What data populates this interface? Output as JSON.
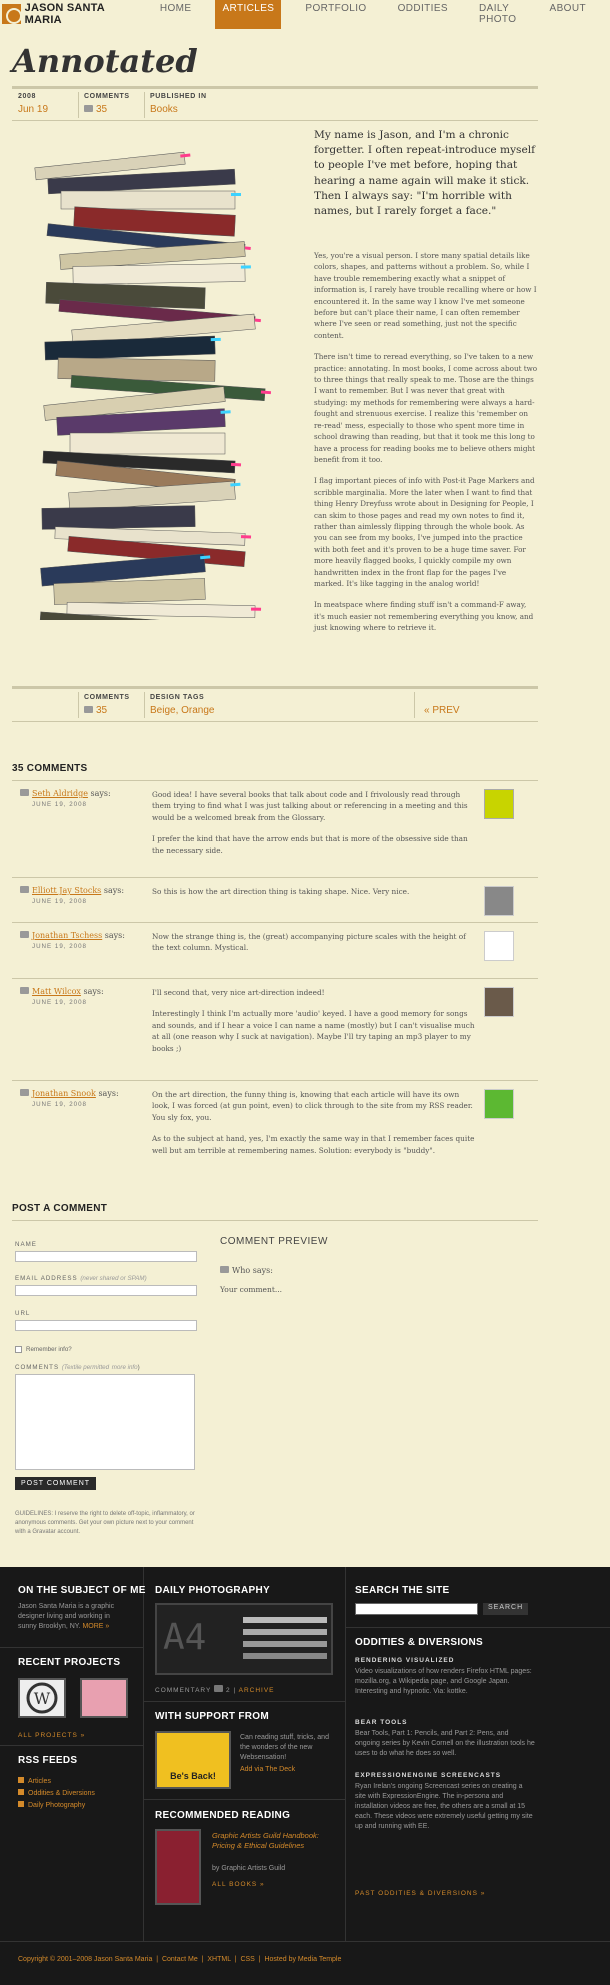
{
  "header": {
    "logo_text": "JASON SANTA MARIA",
    "nav": [
      {
        "label": "HOME"
      },
      {
        "label": "ARTICLES"
      },
      {
        "label": "PORTFOLIO"
      },
      {
        "label": "ODDITIES"
      },
      {
        "label": "DAILY PHOTO"
      },
      {
        "label": "ABOUT"
      }
    ]
  },
  "article": {
    "title": "Annotated",
    "meta": {
      "year": "2008",
      "date": "Jun 19",
      "comments_label": "COMMENTS",
      "comments_count": "35",
      "published_label": "PUBLISHED IN",
      "published_value": "Books"
    },
    "intro": "My name is Jason, and I'm a chronic forgetter. I often repeat-introduce myself to people I've met before, hoping that hearing a name again will make it stick. Then I always say: \"I'm horrible with names, but I rarely forget a face.\"",
    "paragraphs": [
      "Yes, you're a visual person. I store many spatial details like colors, shapes, and patterns without a problem. So, while I have trouble remembering exactly what a snippet of information is, I rarely have trouble recalling where or how I encountered it. In the same way I know I've met someone before but can't place their name, I can often remember where I've seen or read something, just not the specific content.",
      "There isn't time to reread everything, so I've taken to a new practice: annotating. In most books, I come across about two to three things that really speak to me. Those are the things I want to remember. But I was never that great with studying: my methods for remembering were always a hard-fought and strenuous exercise. I realize this 'remember on re-read' mess, especially to those who spent more time in school drawing than reading, but that it took me this long to have a process for reading books me to believe others might benefit from it too.",
      "I flag important pieces of info with Post-it Page Markers and scribble marginalia. More the later when I want to find that thing Henry Dreyfuss wrote about in Designing for People, I can skim to those pages and read my own notes to find it, rather than aimlessly flipping through the whole book. As you can see from my books, I've jumped into the practice with both feet and it's proven to be a huge time saver. For more heavily flagged books, I quickly compile my own handwritten index in the front flap for the pages I've marked. It's like tagging in the analog world!",
      "In meatspace where finding stuff isn't a command-F away, it's much easier not remembering everything you know, and just knowing where to retrieve it."
    ],
    "bottom_meta": {
      "comments_label": "COMMENTS",
      "comments_count": "35",
      "design_tags_label": "DESIGN TAGS",
      "design_tags_value": "Beige, Orange",
      "prev_label": "« PREV"
    }
  },
  "comments": {
    "title": "35 COMMENTS",
    "items": [
      {
        "author": "Seth Aldridge",
        "says": "says:",
        "date": "JUNE 19, 2008",
        "paragraphs": [
          "Good idea! I have several books that talk about code and I frivolously read through them trying to find what I was just talking about or referencing in a meeting and this would be a welcomed break from the Glossary.",
          "I prefer the kind that have the arrow ends but that is more of the obsessive side than the necessary side."
        ]
      },
      {
        "author": "Elliott Jay Stocks",
        "says": "says:",
        "date": "JUNE 19, 2008",
        "paragraphs": [
          "So this is how the art direction thing is taking shape. Nice. Very nice."
        ]
      },
      {
        "author": "Jonathan Tschess",
        "says": "says:",
        "date": "JUNE 19, 2008",
        "paragraphs": [
          "Now the strange thing is, the (great) accompanying picture scales with the height of the text column. Mystical."
        ]
      },
      {
        "author": "Matt Wilcox",
        "says": "says:",
        "date": "JUNE 19, 2008",
        "paragraphs": [
          "I'll second that, very nice art-direction indeed!",
          "Interestingly I think I'm actually more 'audio' keyed. I have a good memory for songs and sounds, and if I hear a voice I can name a name (mostly) but I can't visualise much at all (one reason why I suck at navigation). Maybe I'll try taping an mp3 player to my books ;)"
        ]
      },
      {
        "author": "Jonathan Snook",
        "says": "says:",
        "date": "JUNE 19, 2008",
        "paragraphs": [
          "On the art direction, the funny thing is, knowing that each article will have its own look, I was forced (at gun point, even) to click through to the site from my RSS reader. You sly fox, you.",
          "As to the subject at hand, yes, I'm exactly the same way in that I remember faces quite well but am terrible at remembering names. Solution: everybody is \"buddy\"."
        ]
      }
    ]
  },
  "post_comment": {
    "title": "POST A COMMENT",
    "name_label": "NAME",
    "email_label": "EMAIL ADDRESS",
    "email_note": "(never shared or SPAM)",
    "url_label": "URL",
    "remember_label": "Remember info?",
    "comments_label": "COMMENTS",
    "comments_note": "(Textile permitted",
    "comments_link": "more info",
    "post_button": "POST COMMENT",
    "guidelines": "GUIDELINES: I reserve the right to delete off-topic, inflammatory, or anonymous comments. Get your own picture next to your comment with a Gravatar account.",
    "preview_title": "COMMENT PREVIEW",
    "preview_who": "Who says:",
    "preview_body": "Your comment..."
  },
  "footer": {
    "about_title": "ON THE SUBJECT OF ME",
    "about_text": "Jason Santa Maria is a graphic designer living and working in sunny Brooklyn, NY.",
    "about_more": "MORE »",
    "projects_title": "RECENT PROJECTS",
    "projects_link": "ALL PROJECTS »",
    "rss_title": "RSS FEEDS",
    "rss_items": [
      {
        "label": "Articles"
      },
      {
        "label": "Oddities & Diversions"
      },
      {
        "label": "Daily Photography"
      }
    ],
    "photo_title": "DAILY PHOTOGRAPHY",
    "photo_commentary": "COMMENTARY",
    "photo_count": "2",
    "photo_archive": "ARCHIVE",
    "support_title": "WITH SUPPORT FROM",
    "support_text": "Can reading stuff, tricks, and the wonders of the new Websensation!",
    "support_link": "Add via The Deck",
    "support_badge": "Be's Back!",
    "reading_title": "RECOMMENDED READING",
    "reading_book": "Graphic Artists Guild Handbook: Pricing & Ethical Guidelines",
    "reading_author": "by Graphic Artists Guild",
    "reading_link": "ALL BOOKS »",
    "search_title": "SEARCH THE SITE",
    "search_button": "SEARCH",
    "oddities_title": "ODDITIES & DIVERSIONS",
    "oddities": [
      {
        "title": "RENDERING VISUALIZED",
        "text": "Video visualizations of how renders Firefox HTML pages: mozilla.org, a Wikipedia page, and Google Japan. Interesting and hypnotic. Via: kottke."
      },
      {
        "title": "BEAR TOOLS",
        "text": "Bear Tools, Part 1: Pencils, and Part 2: Pens, and ongoing series by Kevin Cornell on the illustration tools he uses to do what he does so well."
      },
      {
        "title": "EXPRESSIONENGINE SCREENCASTS",
        "text": "Ryan Irelan's ongoing Screencast series on creating a site with ExpressionEngine. The in-persona and installation videos are free, the others are a small at 15 each. These videos were extremely useful getting my site up and running with EE."
      }
    ],
    "oddities_link": "PAST ODDITIES & DIVERSIONS »",
    "copyright": "Copyright © 2001–2008 Jason Santa Maria",
    "bottom_links": [
      {
        "label": "Contact Me"
      },
      {
        "label": "XHTML"
      },
      {
        "label": "CSS"
      },
      {
        "label": "Hosted by Media Temple"
      }
    ]
  },
  "colors": {
    "accent": "#c8781a",
    "background": "#f4f0d4",
    "footer": "#181818"
  }
}
